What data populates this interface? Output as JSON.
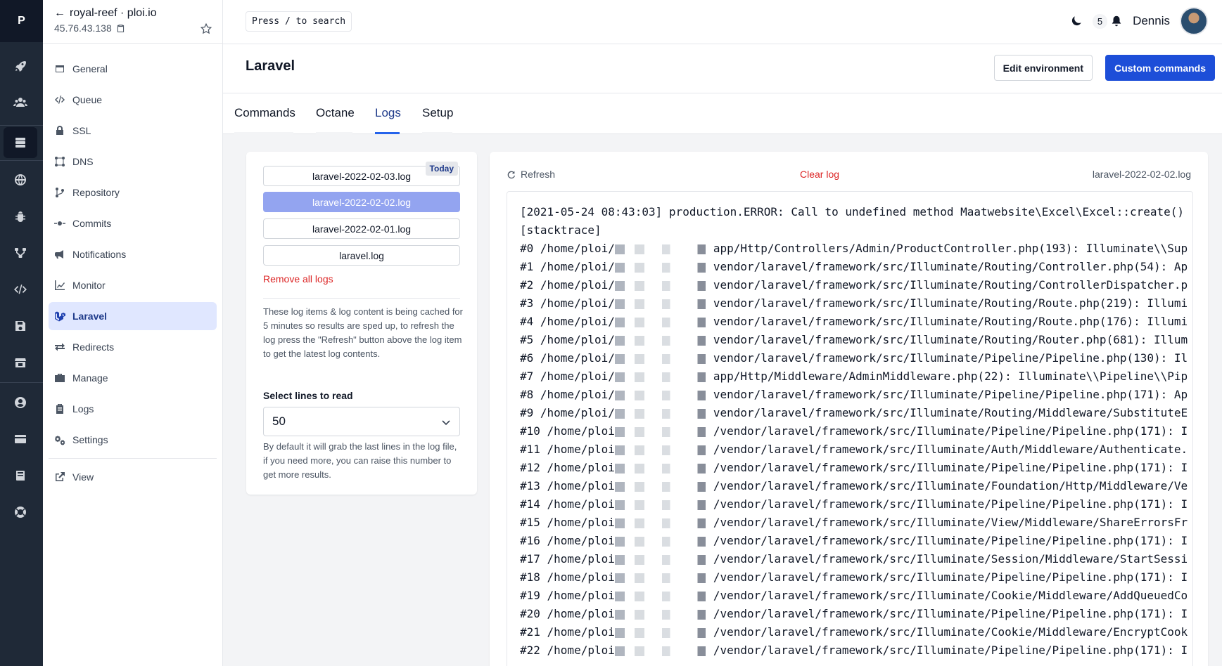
{
  "app": {
    "logo": "P"
  },
  "site": {
    "name": "royal-reef · ploi.io",
    "ip": "45.76.43.138"
  },
  "rail_icons": [
    "rocket-icon",
    "users-icon",
    "servers-icon",
    "globe-icon",
    "bug-icon",
    "network-icon",
    "code-icon",
    "save-icon",
    "store-icon",
    "user-circle-icon",
    "credit-card-icon",
    "book-icon",
    "support-icon"
  ],
  "sidebar": {
    "items": [
      {
        "label": "General",
        "icon": "window-icon"
      },
      {
        "label": "Queue",
        "icon": "code-icon"
      },
      {
        "label": "SSL",
        "icon": "lock-icon"
      },
      {
        "label": "DNS",
        "icon": "dns-icon"
      },
      {
        "label": "Repository",
        "icon": "git-branch-icon"
      },
      {
        "label": "Commits",
        "icon": "commit-icon"
      },
      {
        "label": "Notifications",
        "icon": "megaphone-icon"
      },
      {
        "label": "Monitor",
        "icon": "chart-icon"
      },
      {
        "label": "Laravel",
        "icon": "laravel-icon"
      },
      {
        "label": "Redirects",
        "icon": "redirect-icon"
      },
      {
        "label": "Manage",
        "icon": "briefcase-icon"
      },
      {
        "label": "Logs",
        "icon": "clipboard-icon"
      },
      {
        "label": "Settings",
        "icon": "cogs-icon"
      }
    ],
    "view_label": "View"
  },
  "header": {
    "search_placeholder": "Press / to search",
    "notification_count": "5",
    "user_name": "Dennis"
  },
  "page": {
    "title": "Laravel",
    "edit_env_label": "Edit environment",
    "custom_commands_label": "Custom commands"
  },
  "tabs": [
    "Commands",
    "Octane",
    "Logs",
    "Setup"
  ],
  "logs_panel": {
    "files": [
      "laravel-2022-02-03.log",
      "laravel-2022-02-02.log",
      "laravel-2022-02-01.log",
      "laravel.log"
    ],
    "today_badge": "Today",
    "remove_all_label": "Remove all logs",
    "cache_note": "These log items & log content is being cached for 5 minutes so results are sped up, to refresh the log press the \"Refresh\" button above the log item to get the latest log contents.",
    "select_label": "Select lines to read",
    "select_value": "50",
    "select_note": "By default it will grab the last lines in the log file, if you need more, you can raise this number to get more results."
  },
  "log_view": {
    "refresh_label": "Refresh",
    "clear_label": "Clear log",
    "current_file": "laravel-2022-02-02.log",
    "header_line": "[2021-05-24 08:43:03] production.ERROR: Call to undefined method Maatwebsite\\Excel\\Excel::create()",
    "stack_line": "[stacktrace]",
    "lines": [
      {
        "pre": "#0 /home/ploi/",
        "post": "app/Http/Controllers/Admin/ProductController.php(193): Illuminate\\\\Sup"
      },
      {
        "pre": "#1 /home/ploi/",
        "post": "vendor/laravel/framework/src/Illuminate/Routing/Controller.php(54): Ap"
      },
      {
        "pre": "#2 /home/ploi/",
        "post": "vendor/laravel/framework/src/Illuminate/Routing/ControllerDispatcher.p"
      },
      {
        "pre": "#3 /home/ploi/",
        "post": "vendor/laravel/framework/src/Illuminate/Routing/Route.php(219): Illumi"
      },
      {
        "pre": "#4 /home/ploi/",
        "post": "vendor/laravel/framework/src/Illuminate/Routing/Route.php(176): Illumi"
      },
      {
        "pre": "#5 /home/ploi/",
        "post": "vendor/laravel/framework/src/Illuminate/Routing/Router.php(681): Illum"
      },
      {
        "pre": "#6 /home/ploi/",
        "post": "vendor/laravel/framework/src/Illuminate/Pipeline/Pipeline.php(130): Il"
      },
      {
        "pre": "#7 /home/ploi/",
        "post": "app/Http/Middleware/AdminMiddleware.php(22): Illuminate\\\\Pipeline\\\\Pip"
      },
      {
        "pre": "#8 /home/ploi/",
        "post": "vendor/laravel/framework/src/Illuminate/Pipeline/Pipeline.php(171): Ap"
      },
      {
        "pre": "#9 /home/ploi/",
        "post": "vendor/laravel/framework/src/Illuminate/Routing/Middleware/SubstituteE"
      },
      {
        "pre": "#10 /home/ploi",
        "post": "/vendor/laravel/framework/src/Illuminate/Pipeline/Pipeline.php(171): I"
      },
      {
        "pre": "#11 /home/ploi",
        "post": "/vendor/laravel/framework/src/Illuminate/Auth/Middleware/Authenticate."
      },
      {
        "pre": "#12 /home/ploi",
        "post": "/vendor/laravel/framework/src/Illuminate/Pipeline/Pipeline.php(171): I"
      },
      {
        "pre": "#13 /home/ploi",
        "post": "/vendor/laravel/framework/src/Illuminate/Foundation/Http/Middleware/Ve"
      },
      {
        "pre": "#14 /home/ploi",
        "post": "/vendor/laravel/framework/src/Illuminate/Pipeline/Pipeline.php(171): I"
      },
      {
        "pre": "#15 /home/ploi",
        "post": "/vendor/laravel/framework/src/Illuminate/View/Middleware/ShareErrorsFr"
      },
      {
        "pre": "#16 /home/ploi",
        "post": "/vendor/laravel/framework/src/Illuminate/Pipeline/Pipeline.php(171): I"
      },
      {
        "pre": "#17 /home/ploi",
        "post": "/vendor/laravel/framework/src/Illuminate/Session/Middleware/StartSessi"
      },
      {
        "pre": "#18 /home/ploi",
        "post": "/vendor/laravel/framework/src/Illuminate/Pipeline/Pipeline.php(171): I"
      },
      {
        "pre": "#19 /home/ploi",
        "post": "/vendor/laravel/framework/src/Illuminate/Cookie/Middleware/AddQueuedCo"
      },
      {
        "pre": "#20 /home/ploi",
        "post": "/vendor/laravel/framework/src/Illuminate/Pipeline/Pipeline.php(171): I"
      },
      {
        "pre": "#21 /home/ploi",
        "post": "/vendor/laravel/framework/src/Illuminate/Cookie/Middleware/EncryptCook"
      },
      {
        "pre": "#22 /home/ploi",
        "post": "/vendor/laravel/framework/src/Illuminate/Pipeline/Pipeline.php(171): I"
      }
    ]
  },
  "colors": {
    "primary": "#1d4ed8",
    "danger": "#dc2626",
    "rail_bg": "#1f2937",
    "active_nav_bg": "#e0e7ff",
    "selected_log": "#93a4f0"
  }
}
